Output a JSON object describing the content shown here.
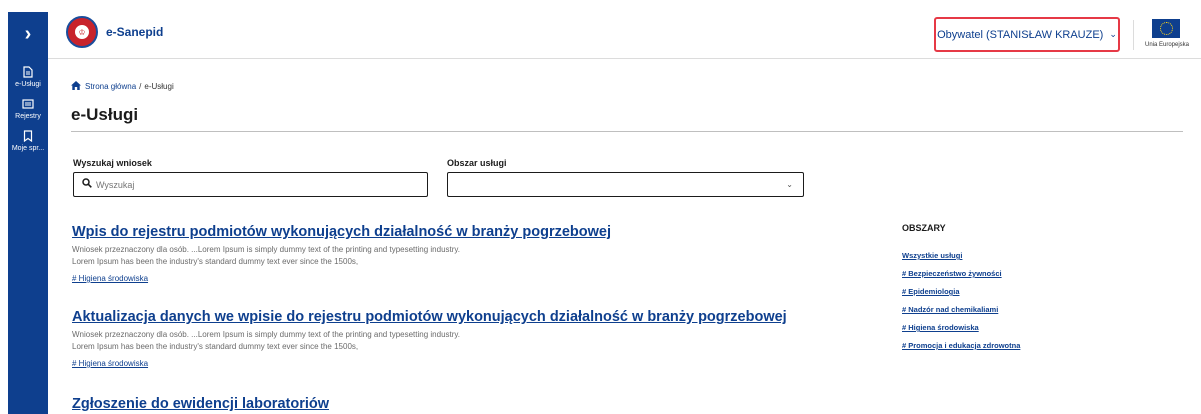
{
  "sidebar": {
    "toggle_icon": "chevron-right-icon",
    "items": [
      {
        "icon": "document-icon",
        "label": "e-Usługi"
      },
      {
        "icon": "folder-icon",
        "label": "Rejestry"
      },
      {
        "icon": "bookmark-icon",
        "label": "Moje spr..."
      }
    ]
  },
  "header": {
    "brand": "e-Sanepid",
    "user": "Obywatel (STANISŁAW KRAUZE)",
    "eu_label": "Unia Europejska"
  },
  "breadcrumb": {
    "home": "Strona główna",
    "separator": "/",
    "current": "e-Usługi"
  },
  "page": {
    "title": "e-Usługi"
  },
  "filters": {
    "search_label": "Wyszukaj wniosek",
    "search_placeholder": "Wyszukaj",
    "area_label": "Obszar usługi",
    "area_value": ""
  },
  "services": [
    {
      "title": "Wpis do rejestru podmiotów wykonujących działalność w branży pogrzebowej",
      "desc_line1": "Wniosek przeznaczony dla osób. ...Lorem Ipsum is simply dummy text of the printing and typesetting industry.",
      "desc_line2": "Lorem Ipsum has been the industry's standard dummy text ever since the 1500s,",
      "tag": "# Higiena środowiska"
    },
    {
      "title": "Aktualizacja danych we wpisie do rejestru podmiotów wykonujących działalność w branży pogrzebowej",
      "desc_line1": "Wniosek przeznaczony dla osób. ...Lorem Ipsum is simply dummy text of the printing and typesetting industry.",
      "desc_line2": "Lorem Ipsum has been the industry's standard dummy text ever since the 1500s,",
      "tag": "# Higiena środowiska"
    },
    {
      "title": "Zgłoszenie do ewidencji laboratoriów"
    }
  ],
  "areas": {
    "title": "OBSZARY",
    "links": [
      "Wszystkie usługi",
      "# Bezpieczeństwo żywności",
      "# Epidemiologia",
      "# Nadzór nad chemikaliami",
      "# Higiena środowiska",
      "# Promocja i edukacja zdrowotna"
    ]
  },
  "colors": {
    "primary": "#0e3f8e",
    "highlight_border": "#e63946"
  }
}
